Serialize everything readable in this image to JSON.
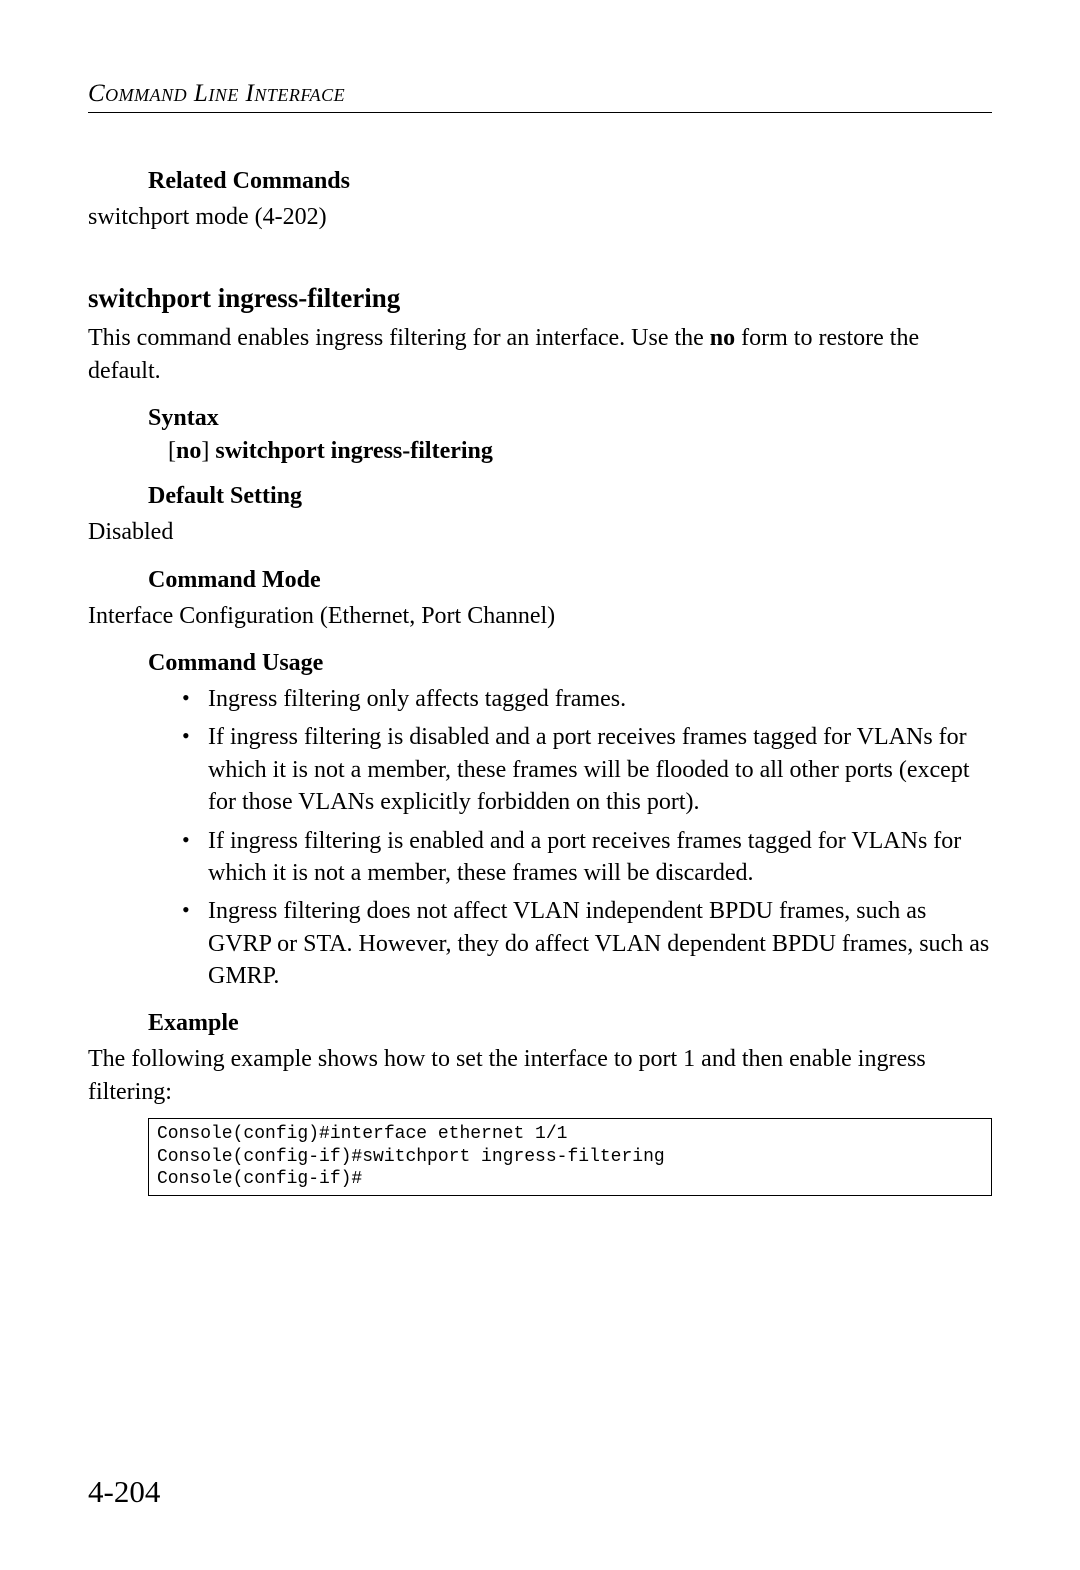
{
  "header": "Command Line Interface",
  "relatedCommands": {
    "heading": "Related Commands",
    "item": "switchport mode (4-202)"
  },
  "section": {
    "title": "switchport ingress-filtering",
    "intro_pre": "This command enables ingress filtering for an interface. Use the ",
    "intro_bold": "no",
    "intro_post": " form to restore the default."
  },
  "syntax": {
    "heading": "Syntax",
    "line": "[no] switchport ingress-filtering"
  },
  "defaultSetting": {
    "heading": "Default Setting",
    "value": "Disabled"
  },
  "commandMode": {
    "heading": "Command Mode",
    "value": "Interface Configuration (Ethernet, Port Channel)"
  },
  "commandUsage": {
    "heading": "Command Usage",
    "bullets": [
      "Ingress filtering only affects tagged frames.",
      "If ingress filtering is disabled and a port receives frames tagged for VLANs for which it is not a member, these frames will be flooded to all other ports (except for those VLANs explicitly forbidden on this port).",
      "If ingress filtering is enabled and a port receives frames tagged for VLANs for which it is not a member, these frames will be discarded.",
      "Ingress filtering does not affect VLAN independent BPDU frames, such as GVRP or STA. However, they do affect VLAN dependent BPDU frames, such as GMRP."
    ]
  },
  "example": {
    "heading": "Example",
    "intro": "The following example shows how to set the interface to port 1 and then enable ingress filtering:",
    "code": "Console(config)#interface ethernet 1/1\nConsole(config-if)#switchport ingress-filtering\nConsole(config-if)#"
  },
  "pageNumber": "4-204"
}
